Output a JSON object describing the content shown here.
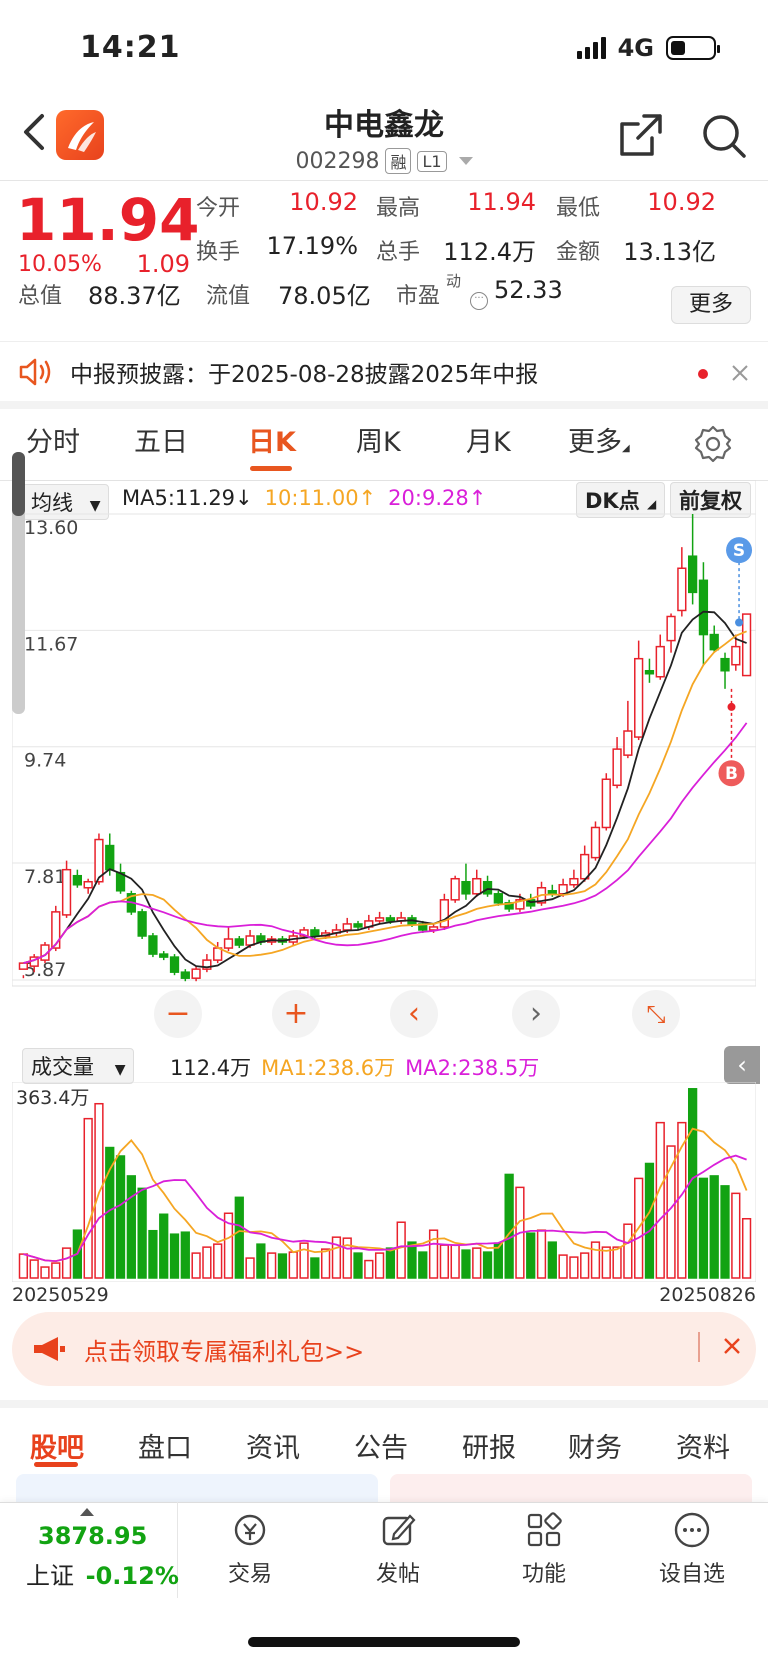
{
  "status": {
    "time": "14:21",
    "network": "4G"
  },
  "header": {
    "name": "中电鑫龙",
    "code": "002298",
    "tag_margin": "融",
    "tag_level": "L1"
  },
  "quote": {
    "price": "11.94",
    "change_pct": "10.05%",
    "change": "1.09",
    "rows": [
      [
        {
          "label": "今开",
          "value": "10.92",
          "color": "red"
        },
        {
          "label": "最高",
          "value": "11.94",
          "color": "red"
        },
        {
          "label": "最低",
          "value": "10.92",
          "color": "red"
        }
      ],
      [
        {
          "label": "换手",
          "value": "17.19%",
          "color": "black"
        },
        {
          "label": "总手",
          "value": "112.4万",
          "color": "black"
        },
        {
          "label": "金额",
          "value": "13.13亿",
          "color": "black"
        }
      ],
      [
        {
          "label": "总值",
          "value": "88.37亿",
          "color": "black"
        },
        {
          "label": "流值",
          "value": "78.05亿",
          "color": "black"
        },
        {
          "label": "市盈",
          "value": "52.33",
          "color": "black"
        }
      ]
    ],
    "pe_superscript": "动",
    "more_label": "更多"
  },
  "notice": {
    "text": "中报预披露：于2025-08-28披露2025年中报"
  },
  "period_tabs": [
    "分时",
    "五日",
    "日K",
    "周K",
    "月K",
    "更多"
  ],
  "period_active": 2,
  "chart_toolbar": {
    "indicator": "均线",
    "dk": "DK点",
    "adjust": "前复权"
  },
  "ma_legend": {
    "ma5": "MA5:11.29↓",
    "ma10": "10:11.00↑",
    "ma20": "20:9.28↑"
  },
  "volume_toolbar": {
    "indicator": "成交量",
    "current": "112.4万",
    "ma1": "MA1:238.6万",
    "ma2": "MA2:238.5万"
  },
  "colors": {
    "up": "#e8212b",
    "down": "#12a312",
    "ma5": "#222222",
    "ma10": "#f5a623",
    "ma20": "#d91fd9",
    "accent": "#e8561f"
  },
  "chart_data": {
    "type": "candlestick",
    "ylabels": [
      "13.60",
      "11.67",
      "9.74",
      "7.81",
      "5.87"
    ],
    "ylim": [
      5.87,
      13.6
    ],
    "vol_label": "363.4万",
    "vol_max": 363.4,
    "date_start": "20250529",
    "date_end": "20250826",
    "signals": [
      {
        "label": "S"
      },
      {
        "label": "B"
      }
    ],
    "candles": [
      [
        6.05,
        6.15,
        5.95,
        5.9
      ],
      [
        6.1,
        6.25,
        6.0,
        6.3
      ],
      [
        6.2,
        6.45,
        6.15,
        6.5
      ],
      [
        6.4,
        7.0,
        6.35,
        7.1
      ],
      [
        6.95,
        7.7,
        6.9,
        7.85
      ],
      [
        7.6,
        7.45,
        7.4,
        7.7
      ],
      [
        7.4,
        7.5,
        7.3,
        7.55
      ],
      [
        7.5,
        8.2,
        7.45,
        8.3
      ],
      [
        8.1,
        7.7,
        7.6,
        8.3
      ],
      [
        7.65,
        7.35,
        7.3,
        7.8
      ],
      [
        7.3,
        7.0,
        6.95,
        7.35
      ],
      [
        7.0,
        6.6,
        6.55,
        7.05
      ],
      [
        6.6,
        6.3,
        6.25,
        6.65
      ],
      [
        6.3,
        6.25,
        6.2,
        6.35
      ],
      [
        6.25,
        6.0,
        5.95,
        6.3
      ],
      [
        6.0,
        5.9,
        5.85,
        6.05
      ],
      [
        5.9,
        6.05,
        5.85,
        6.1
      ],
      [
        6.05,
        6.2,
        6.0,
        6.3
      ],
      [
        6.2,
        6.4,
        6.15,
        6.5
      ],
      [
        6.4,
        6.55,
        6.35,
        6.75
      ],
      [
        6.55,
        6.45,
        6.4,
        6.6
      ],
      [
        6.45,
        6.6,
        6.4,
        6.7
      ],
      [
        6.6,
        6.5,
        6.45,
        6.65
      ],
      [
        6.5,
        6.55,
        6.45,
        6.6
      ],
      [
        6.55,
        6.5,
        6.45,
        6.6
      ],
      [
        6.5,
        6.6,
        6.45,
        6.7
      ],
      [
        6.6,
        6.7,
        6.55,
        6.75
      ],
      [
        6.7,
        6.6,
        6.55,
        6.75
      ],
      [
        6.6,
        6.65,
        6.55,
        6.7
      ],
      [
        6.65,
        6.7,
        6.6,
        6.8
      ],
      [
        6.7,
        6.8,
        6.65,
        6.9
      ],
      [
        6.8,
        6.75,
        6.7,
        6.85
      ],
      [
        6.75,
        6.85,
        6.7,
        6.95
      ],
      [
        6.85,
        6.9,
        6.8,
        7.0
      ],
      [
        6.9,
        6.85,
        6.8,
        6.95
      ],
      [
        6.85,
        6.9,
        6.8,
        7.0
      ],
      [
        6.9,
        6.8,
        6.75,
        6.95
      ],
      [
        6.8,
        6.7,
        6.65,
        6.85
      ],
      [
        6.7,
        6.75,
        6.65,
        6.8
      ],
      [
        6.75,
        7.2,
        6.7,
        7.3
      ],
      [
        7.2,
        7.55,
        7.15,
        7.6
      ],
      [
        7.5,
        7.3,
        7.2,
        7.8
      ],
      [
        7.3,
        7.55,
        7.25,
        7.7
      ],
      [
        7.5,
        7.3,
        7.25,
        7.6
      ],
      [
        7.3,
        7.15,
        7.1,
        7.35
      ],
      [
        7.15,
        7.05,
        7.0,
        7.2
      ],
      [
        7.05,
        7.2,
        7.0,
        7.3
      ],
      [
        7.2,
        7.1,
        7.05,
        7.3
      ],
      [
        7.15,
        7.4,
        7.1,
        7.5
      ],
      [
        7.35,
        7.3,
        7.25,
        7.45
      ],
      [
        7.3,
        7.45,
        7.25,
        7.55
      ],
      [
        7.45,
        7.55,
        7.4,
        7.7
      ],
      [
        7.55,
        7.95,
        7.5,
        8.1
      ],
      [
        7.9,
        8.4,
        7.85,
        8.5
      ],
      [
        8.4,
        9.2,
        8.35,
        9.3
      ],
      [
        9.1,
        9.7,
        9.05,
        9.9
      ],
      [
        9.6,
        10.0,
        9.55,
        10.5
      ],
      [
        9.9,
        11.2,
        9.85,
        11.5
      ],
      [
        11.0,
        10.95,
        10.8,
        11.2
      ],
      [
        10.9,
        11.4,
        10.85,
        11.6
      ],
      [
        11.5,
        11.9,
        11.3,
        11.95
      ],
      [
        12.0,
        12.7,
        11.9,
        13.05
      ],
      [
        12.9,
        12.3,
        12.1,
        13.6
      ],
      [
        12.5,
        11.6,
        11.1,
        12.8
      ],
      [
        11.6,
        11.35,
        11.3,
        11.75
      ],
      [
        11.2,
        11.0,
        10.7,
        11.3
      ],
      [
        11.1,
        11.4,
        11.0,
        11.6
      ],
      [
        10.92,
        11.94,
        10.92,
        11.94
      ]
    ],
    "volumes": [
      48,
      36,
      22,
      30,
      60,
      96,
      320,
      350,
      262,
      245,
      205,
      180,
      95,
      128,
      88,
      92,
      50,
      62,
      68,
      130,
      162,
      40,
      68,
      50,
      48,
      52,
      70,
      40,
      58,
      82,
      80,
      50,
      35,
      50,
      60,
      112,
      72,
      52,
      96,
      66,
      66,
      56,
      60,
      52,
      70,
      208,
      182,
      90,
      96,
      72,
      46,
      42,
      50,
      72,
      62,
      62,
      108,
      200,
      230,
      312,
      265,
      312,
      380,
      200,
      205,
      185,
      170,
      119
    ]
  },
  "promo": {
    "text": "点击领取专属福利礼包>>"
  },
  "content_tabs": [
    "股吧",
    "盘口",
    "资讯",
    "公告",
    "研报",
    "财务",
    "资料"
  ],
  "bottom_nav": {
    "index_value": "3878.95",
    "index_name": "上证",
    "index_change": "-0.12%",
    "items": [
      "交易",
      "发帖",
      "功能",
      "设自选"
    ]
  }
}
